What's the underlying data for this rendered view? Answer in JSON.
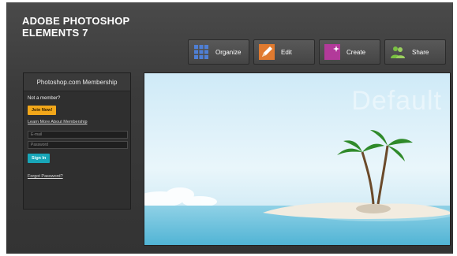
{
  "window": {
    "title": "ADOBE PHOTOSHOP ELEMENTS 7"
  },
  "toolbar": {
    "buttons": [
      {
        "label": "Organize",
        "icon": "organize-grid-icon"
      },
      {
        "label": "Edit",
        "icon": "edit-pencil-icon"
      },
      {
        "label": "Create",
        "icon": "create-star-icon"
      },
      {
        "label": "Share",
        "icon": "share-people-icon"
      }
    ]
  },
  "membership": {
    "header": "Photoshop.com Membership",
    "not_member": "Not a member?",
    "join_button": "Join Now!",
    "learn_more": "Learn More About Membership",
    "email_placeholder": "E-mail",
    "password_placeholder": "Password",
    "signin_button": "Sign In",
    "forgot": "Forgot Password?"
  },
  "preview": {
    "watermark": "Default"
  },
  "colors": {
    "accent_join": "#f2a71a",
    "accent_signin": "#18a6b8",
    "sky_top": "#cfeaf7",
    "sea": "#6fc4de"
  }
}
